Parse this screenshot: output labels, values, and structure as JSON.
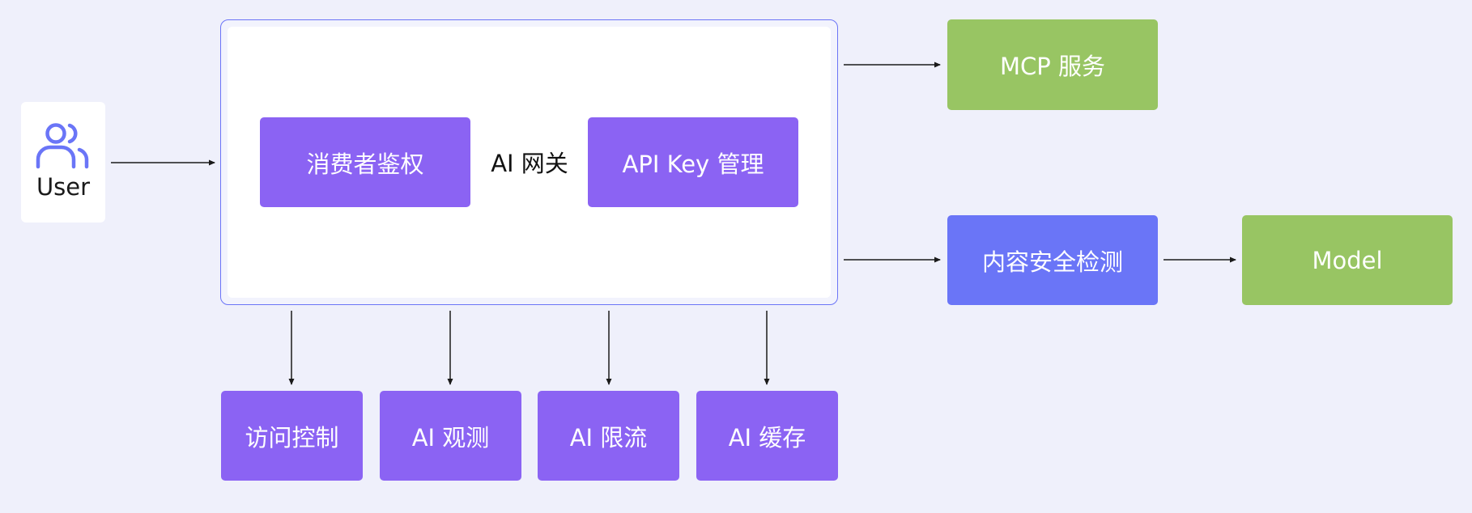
{
  "diagram": {
    "user": {
      "label": "User",
      "icon": "users-icon"
    },
    "gateway": {
      "label": "AI 网关"
    },
    "gateway_modules": [
      {
        "label": "消费者鉴权"
      },
      {
        "label": "API Key 管理"
      }
    ],
    "plugins": [
      {
        "label": "访问控制"
      },
      {
        "label": "AI 观测"
      },
      {
        "label": "AI 限流"
      },
      {
        "label": "AI 缓存"
      }
    ],
    "mcp": {
      "label": "MCP 服务"
    },
    "safety": {
      "label": "内容安全检测"
    },
    "model": {
      "label": "Model"
    },
    "colors": {
      "background": "#eff0fb",
      "purple": "#8b63f3",
      "blue": "#6a75f7",
      "green": "#98c563",
      "gateway_border": "#6b74f7",
      "icon": "#6a75f7",
      "arrow": "#1a1a1a"
    }
  }
}
